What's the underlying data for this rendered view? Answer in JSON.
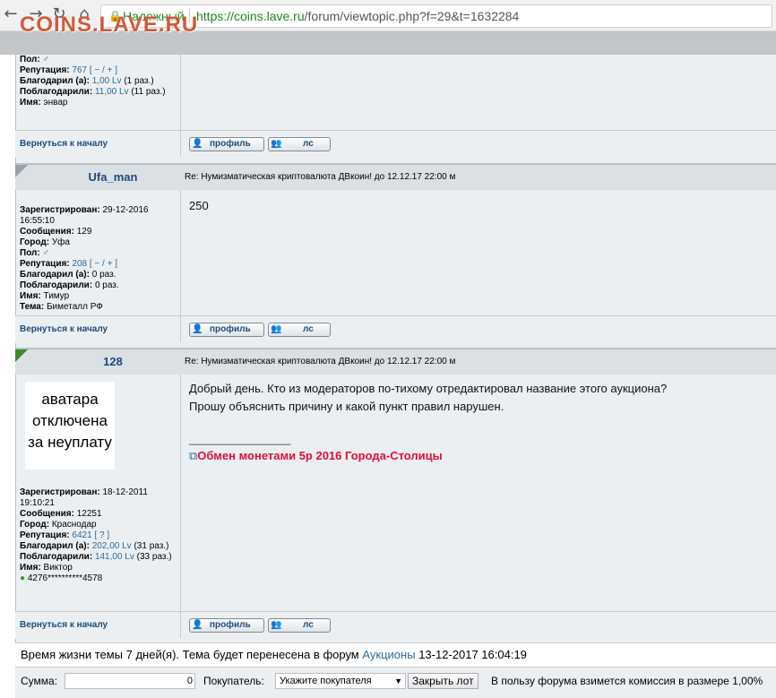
{
  "browser": {
    "secure_label": "Надежный",
    "url_host": "https://coins.lave.ru",
    "url_path": "/forum/viewtopic.php?f=29&t=1632284"
  },
  "site": {
    "logo": "COINS.LAVE.RU"
  },
  "post0": {
    "gender_label": "Пол:",
    "rep_label": "Репутация:",
    "rep_value": "767",
    "rep_actions": "[ − / + ]",
    "thanked_label": "Благодарил (а):",
    "thanked_value": "1,00 Lv",
    "thanked_tail": "(1 раз.)",
    "thanked_by_label": "Поблагодарили:",
    "thanked_by_value": "11,00 Lv",
    "thanked_by_tail": "(11 раз.)",
    "name_label": "Имя:",
    "name_value": "энвар"
  },
  "post1": {
    "username": "Ufa_man",
    "subject": "Re: Нумизматическая криптовалюта ДВкоин! до 12.12.17 22:00 м",
    "reg_label": "Зарегистрирован:",
    "reg_value": "29-12-2016 16:55:10",
    "msgs_label": "Сообщения:",
    "msgs_value": "129",
    "city_label": "Город:",
    "city_value": "Уфа",
    "gender_label": "Пол:",
    "rep_label": "Репутация:",
    "rep_value": "208",
    "rep_actions": "[ − / + ]",
    "thanked_label": "Благодарил (а):",
    "thanked_value": "0 раз.",
    "thanked_by_label": "Поблагодарили:",
    "thanked_by_value": "0 раз.",
    "name_label": "Имя:",
    "name_value": "Тимур",
    "theme_label": "Тема:",
    "theme_value": "Биметалл РФ",
    "body": "250"
  },
  "post2": {
    "username": "128",
    "subject": "Re: Нумизматическая криптовалюта ДВкоин! до 12.12.17 22:00 м",
    "avatar_line1": "аватара",
    "avatar_line2": "отключена",
    "avatar_line3": "за неуплату",
    "reg_label": "Зарегистрирован:",
    "reg_value": "18-12-2011 19:10:21",
    "msgs_label": "Сообщения:",
    "msgs_value": "12251",
    "city_label": "Город:",
    "city_value": "Краснодар",
    "rep_label": "Репутация:",
    "rep_value": "6421",
    "rep_actions": "[ ? ]",
    "thanked_label": "Благодарил (а):",
    "thanked_value": "202,00 Lv",
    "thanked_tail": "(31 раз.)",
    "thanked_by_label": "Поблагодарили:",
    "thanked_by_value": "141,00 Lv",
    "thanked_by_tail": "(33 раз.)",
    "name_label": "Имя:",
    "name_value": "Виктор",
    "card_value": "4276**********4578",
    "body_line1": "Добрый день. Кто из модераторов по-тихому отредактировал название этого аукциона?",
    "body_line2": "Прошу объяснить причину и какой пункт правил нарушен.",
    "sig_line": "_________________",
    "sig_link": "Обмен монетами 5р 2016 Города-Столицы"
  },
  "controls": {
    "back_to_top": "Вернуться к началу",
    "profile_btn": "профиль",
    "pm_btn": "лс"
  },
  "footer": {
    "lifetime_text": "Время жизни темы 7 дней(я). Тема будет перенесена в форум",
    "forum_link": "Аукционы",
    "datetime": "13-12-2017 16:04:19",
    "sum_label": "Сумма:",
    "sum_value": "0",
    "buyer_label": "Покупатель:",
    "buyer_select": "Укажите покупателя",
    "close_lot": "Закрыть лот",
    "commission": "В пользу форума взимется комиссия в размере 1,00%"
  },
  "colors": {
    "flag_gray": "#9aa3ab",
    "flag_green": "#3a8a2a",
    "link": "#2a6a9a",
    "sig_red": "#e0103a"
  }
}
